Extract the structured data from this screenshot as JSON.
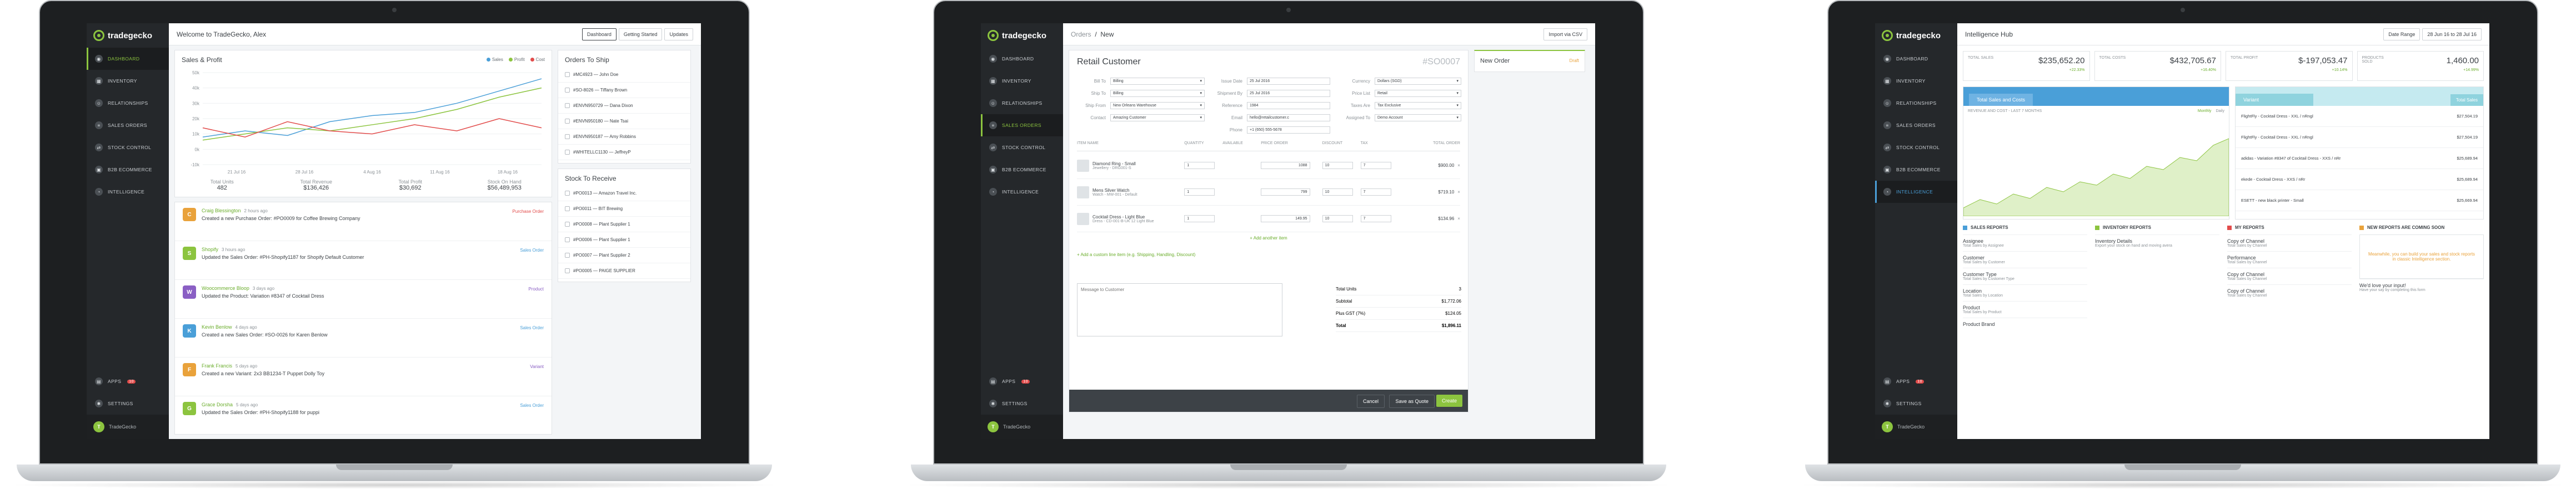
{
  "brand": {
    "name": "tradegecko",
    "accent": "#8cc43f",
    "sidebar_bg": "#25282b"
  },
  "sidebar": {
    "items": [
      "Dashboard",
      "Inventory",
      "Relationships",
      "Sales Orders",
      "Stock Control",
      "B2B Ecommerce",
      "Intelligence"
    ],
    "bottom": [
      "Apps",
      "Settings"
    ],
    "user": "TradeGecko",
    "apps_badge": "10"
  },
  "screen1": {
    "greeting": "Welcome to TradeGecko, Alex",
    "top_buttons": [
      "Dashboard",
      "Getting Started",
      "Updates"
    ],
    "chart": {
      "title": "Sales & Profit",
      "legend": [
        "Sales",
        "Profit",
        "Cost"
      ]
    },
    "chart_data": {
      "type": "line",
      "title": "Sales & Profit",
      "x": [
        "21 Jul 16",
        "28 Jul 16",
        "4 Aug 16",
        "11 Aug 16",
        "18 Aug 16"
      ],
      "yticks": [
        "50k",
        "40k",
        "30k",
        "20k",
        "10k",
        "0k",
        "-10k"
      ],
      "series": [
        {
          "name": "Sales",
          "color": "#4a9fd8",
          "values": [
            8,
            12,
            9,
            18,
            22,
            24,
            30,
            38,
            46
          ]
        },
        {
          "name": "Profit",
          "color": "#8cc43f",
          "values": [
            6,
            10,
            14,
            12,
            16,
            20,
            26,
            34,
            40
          ]
        },
        {
          "name": "Cost",
          "color": "#e24c4b",
          "values": [
            14,
            8,
            18,
            12,
            10,
            16,
            12,
            20,
            14
          ]
        }
      ],
      "ylim": [
        -10,
        50
      ]
    },
    "stats": [
      {
        "label": "Total Units",
        "value": "482"
      },
      {
        "label": "Total Revenue",
        "value": "$136,426"
      },
      {
        "label": "Total Profit",
        "value": "$30,692"
      },
      {
        "label": "Stock On Hand",
        "value": "$56,489,953"
      }
    ],
    "orders_to_ship": {
      "title": "Orders To Ship",
      "items": [
        "#MC4923 — John Doe",
        "#SO-8026 — Tiffany Brown",
        "#ENVN950729 — Dana Dixon",
        "#ENVN950180 — Nate Tsai",
        "#ENVN950187 — Amy Robbins",
        "#WHITELLC1130 — JeffreyP"
      ]
    },
    "stock_to_receive": {
      "title": "Stock To Receive",
      "items": [
        "#PO0013 — Amazon Travel Inc.",
        "#PO0011 — BIT Brewing",
        "#PO0008 — Plant Supplier 1",
        "#PO0006 — Plant Supplier 1",
        "#PO0007 — Plant Supplier 2",
        "#PO0005 — PAIGE SUPPLIER"
      ]
    },
    "feed": [
      {
        "name": "Craig Blessington",
        "time": "2 hours ago",
        "text": "Created a new Purchase Order: #PO0009 for Coffee Brewing Company",
        "tag": "Purchase Order",
        "tag_color": "#e24c4b",
        "icon_bg": "#e9a23b",
        "icon": "C"
      },
      {
        "name": "Shopify",
        "time": "3 hours ago",
        "text": "Updated the Sales Order: #PH-Shopify1187 for Shopify Default Customer",
        "tag": "Sales Order",
        "tag_color": "#4a9fd8",
        "icon_bg": "#8cc43f",
        "icon": "S"
      },
      {
        "name": "Woocommerce Bloop",
        "time": "3 days ago",
        "text": "Updated the Product: Variation #8347 of Cocktail Dress",
        "tag": "Product",
        "tag_color": "#8a5fc4",
        "icon_bg": "#8a5fc4",
        "icon": "W"
      },
      {
        "name": "Kevin Benlow",
        "time": "4 days ago",
        "text": "Created a new Sales Order: #SO-0026 for Karen Benlow",
        "tag": "Sales Order",
        "tag_color": "#4a9fd8",
        "icon_bg": "#4a9fd8",
        "icon": "K"
      },
      {
        "name": "Frank Francis",
        "time": "5 days ago",
        "text": "Created a new Variant: 2x3 BB1234-T Puppet Dolly Toy",
        "tag": "Variant",
        "tag_color": "#8a5fc4",
        "icon_bg": "#e9a23b",
        "icon": "F"
      },
      {
        "name": "Grace Dorsha",
        "time": "5 days ago",
        "text": "Updated the Sales Order: #PH-Shopify1188 for puppi",
        "tag": "Sales Order",
        "tag_color": "#4a9fd8",
        "icon_bg": "#8cc43f",
        "icon": "G"
      }
    ]
  },
  "screen2": {
    "breadcrumb": [
      "Orders",
      "New"
    ],
    "import_btn": "Import via CSV",
    "customer": "Retail Customer",
    "order_no": "#SO0007",
    "fields_left": [
      {
        "label": "Bill To",
        "value": "Billing"
      },
      {
        "label": "Ship To",
        "value": "Billing"
      },
      {
        "label": "Ship From",
        "value": "New Orleans Warehouse"
      },
      {
        "label": "Contact",
        "value": "Amazing Customer"
      }
    ],
    "fields_mid": [
      {
        "label": "Issue Date",
        "value": "25 Jul 2016"
      },
      {
        "label": "Shipment By",
        "value": "25 Jul 2016"
      },
      {
        "label": "Reference",
        "value": "1984"
      },
      {
        "label": "Email",
        "value": "hello@retailcustomer.c"
      },
      {
        "label": "Phone",
        "value": "+1 (650) 555-5678"
      }
    ],
    "fields_right": [
      {
        "label": "Currency",
        "value": "Dollars (SGD)"
      },
      {
        "label": "Price List",
        "value": "Retail"
      },
      {
        "label": "Taxes Are",
        "value": "Tax Exclusive"
      },
      {
        "label": "Assigned To",
        "value": "Demo Account"
      }
    ],
    "new_order": {
      "title": "New Order",
      "status": "Draft"
    },
    "columns": [
      "Item Name",
      "Quantity",
      "Available",
      "Price Order",
      "Discount",
      "Tax",
      "Total Order"
    ],
    "lines": [
      {
        "name": "Diamond Ring - Small",
        "sub": "Jewellery - DRG001-S",
        "qty": "1",
        "price": "1088",
        "disc": "10",
        "tax": "7",
        "total": "$900.00"
      },
      {
        "name": "Mens Silver Watch",
        "sub": "Watch - MW-001 - Default",
        "qty": "1",
        "price": "799",
        "disc": "10",
        "tax": "7",
        "total": "$719.10"
      },
      {
        "name": "Cocktail Dress - Light Blue",
        "sub": "Dress - CD-001-B-UK 12 Light Blue",
        "qty": "1",
        "price": "149.95",
        "disc": "10",
        "tax": "7",
        "total": "$134.96"
      }
    ],
    "add_line": "+ Add another item",
    "add_custom": "+ Add a custom line item (e.g. Shipping, Handling, Discount)",
    "message_placeholder": "Message to Customer",
    "totals": [
      {
        "label": "Total Units",
        "value": "3"
      },
      {
        "label": "Subtotal",
        "value": "$1,772.06"
      },
      {
        "label": "Plus GST (7%)",
        "value": "$124.05"
      },
      {
        "label": "Total",
        "value": "$1,896.11"
      }
    ],
    "footer_buttons": [
      "Cancel",
      "Save as Quote",
      "Create"
    ]
  },
  "screen3": {
    "title": "Intelligence Hub",
    "date_label": "Date Range",
    "date_value": "28 Jun 16 to 28 Jul 16",
    "kpis": [
      {
        "label": "Total Sales",
        "value": "$235,652.20",
        "delta": "+22.33%"
      },
      {
        "label": "Total Costs",
        "value": "$432,705.67",
        "delta": "+16.40%"
      },
      {
        "label": "Total Profit",
        "value": "$-197,053.47",
        "delta": "+10.14%"
      },
      {
        "label": "Products Sold",
        "value": "1,460.00",
        "delta": "+14.99%"
      }
    ],
    "sales_tab": "Total Sales and Costs",
    "revenue_label": "Revenue and Cost - Last 7 Months",
    "period_tabs": [
      "Monthly",
      "Daily"
    ],
    "variant_header": "Variant",
    "variant_value_header": "Total Sales",
    "variants": [
      {
        "name": "FlightFly - Cocktail Dress - XXL / nRngl",
        "value": "$27,504.19"
      },
      {
        "name": "FlightFly - Cocktail Dress - XXL / nRngl",
        "value": "$27,504.19"
      },
      {
        "name": "adidas - Variation #8347 of Cocktail Dress - XXS / nRr",
        "value": "$25,689.94"
      },
      {
        "name": "ekede - Cocktail Dress - XXS / nRr",
        "value": "$25,689.94"
      },
      {
        "name": "ESETT - new black printer - Small",
        "value": "$25,669.94"
      }
    ],
    "report_sections": [
      {
        "title": "Sales Reports",
        "items": [
          [
            "Assignee",
            "Total Sales by Assignee"
          ],
          [
            "Customer",
            "Total Sales by Customer"
          ],
          [
            "Customer Type",
            "Total Sales by Customer Type"
          ],
          [
            "Location",
            "Total Sales by Location"
          ],
          [
            "Product",
            "Total Sales by Product"
          ],
          [
            "Product Brand",
            ""
          ]
        ]
      },
      {
        "title": "Inventory Reports",
        "items": [
          [
            "Inventory Details",
            "Export your stock on hand and moving avera"
          ]
        ]
      },
      {
        "title": "My Reports",
        "items": [
          [
            "Copy of Channel",
            "Total Sales by Channel"
          ],
          [
            "Performance",
            "Total Sales by Channel"
          ],
          [
            "Copy of Channel",
            "Total Sales by Channel"
          ],
          [
            "Copy of Channel",
            "Total Sales by Channel"
          ]
        ]
      },
      {
        "title": "New Reports Are Coming Soon",
        "items": [
          [
            "Meanwhile, you can build your sales and stock reports in classic Intelligence section.",
            ""
          ],
          [
            "We'd love your input!",
            "Have your say by completing this form"
          ]
        ]
      }
    ]
  }
}
